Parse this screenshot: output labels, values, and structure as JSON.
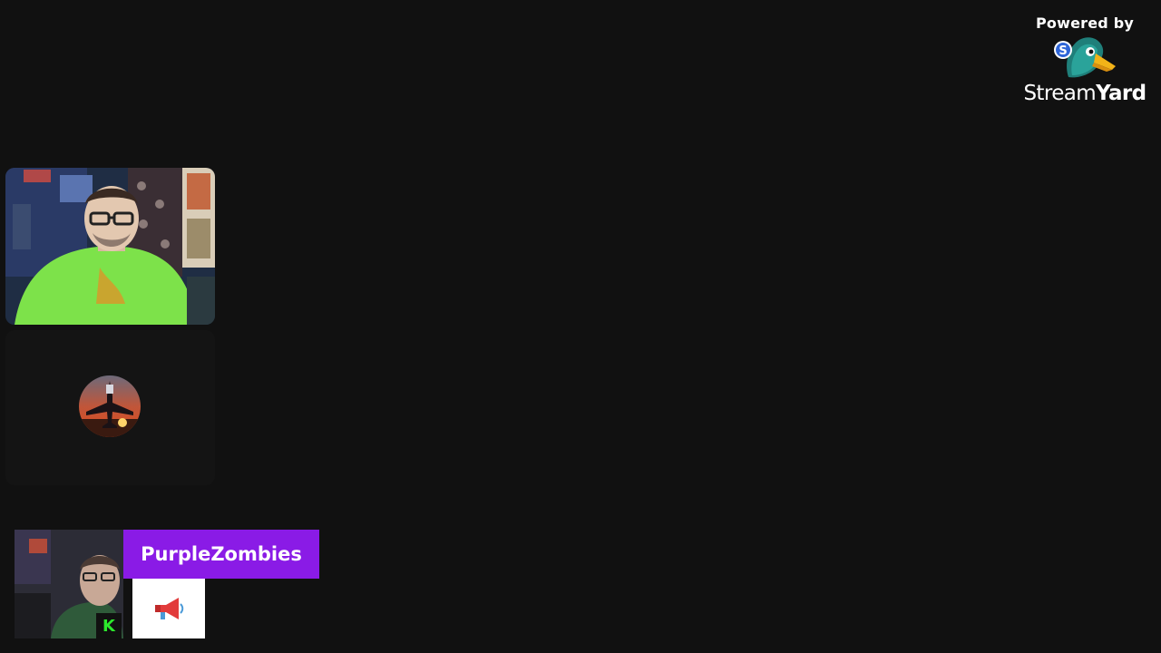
{
  "branding": {
    "powered_by": "Powered by",
    "logo_word_part1": "Stream",
    "logo_word_part2": "Yard",
    "logo_badge_letter": "S"
  },
  "participants": [
    {
      "type": "video",
      "name": ""
    },
    {
      "type": "audio-only",
      "name": ""
    }
  ],
  "lower_third": {
    "name": "PurpleZombies",
    "badge_letter": "K",
    "icon": "megaphone-icon",
    "colors": {
      "banner": "#8a1be6",
      "badge_text": "#2ce82c"
    }
  },
  "theme": {
    "background": "#111111"
  }
}
